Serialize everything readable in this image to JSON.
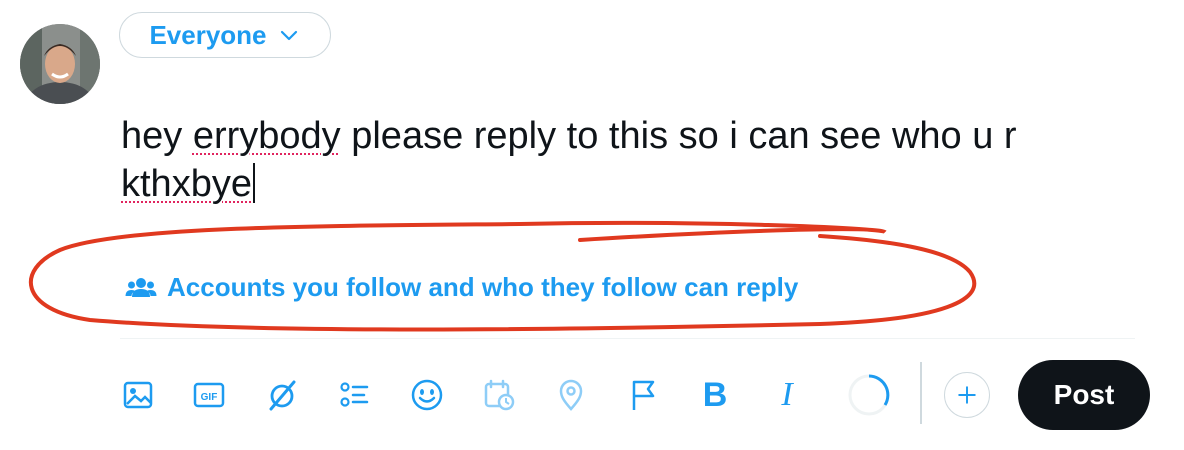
{
  "audience": {
    "label": "Everyone"
  },
  "compose": {
    "text_line1_a": "hey ",
    "text_line1_spell": "errybody",
    "text_line1_b": " please reply to this so i can see who u r",
    "text_line2_spell": "kthxbye"
  },
  "reply_setting": {
    "label": "Accounts you follow and who they follow can reply",
    "icon": "people-icon"
  },
  "toolbar": {
    "icons": [
      "image-icon",
      "gif-icon",
      "grok-icon",
      "poll-icon",
      "emoji-icon",
      "schedule-icon",
      "location-icon",
      "flag-icon",
      "bold-icon",
      "italic-icon",
      "progress-icon",
      "add-icon"
    ],
    "bold_label": "B",
    "italic_label": "I",
    "post_label": "Post"
  },
  "colors": {
    "accent": "#1d9bf0",
    "accent_faded": "#8ecdf7",
    "annotation": "#e0391f",
    "post_bg": "#0f1419"
  }
}
